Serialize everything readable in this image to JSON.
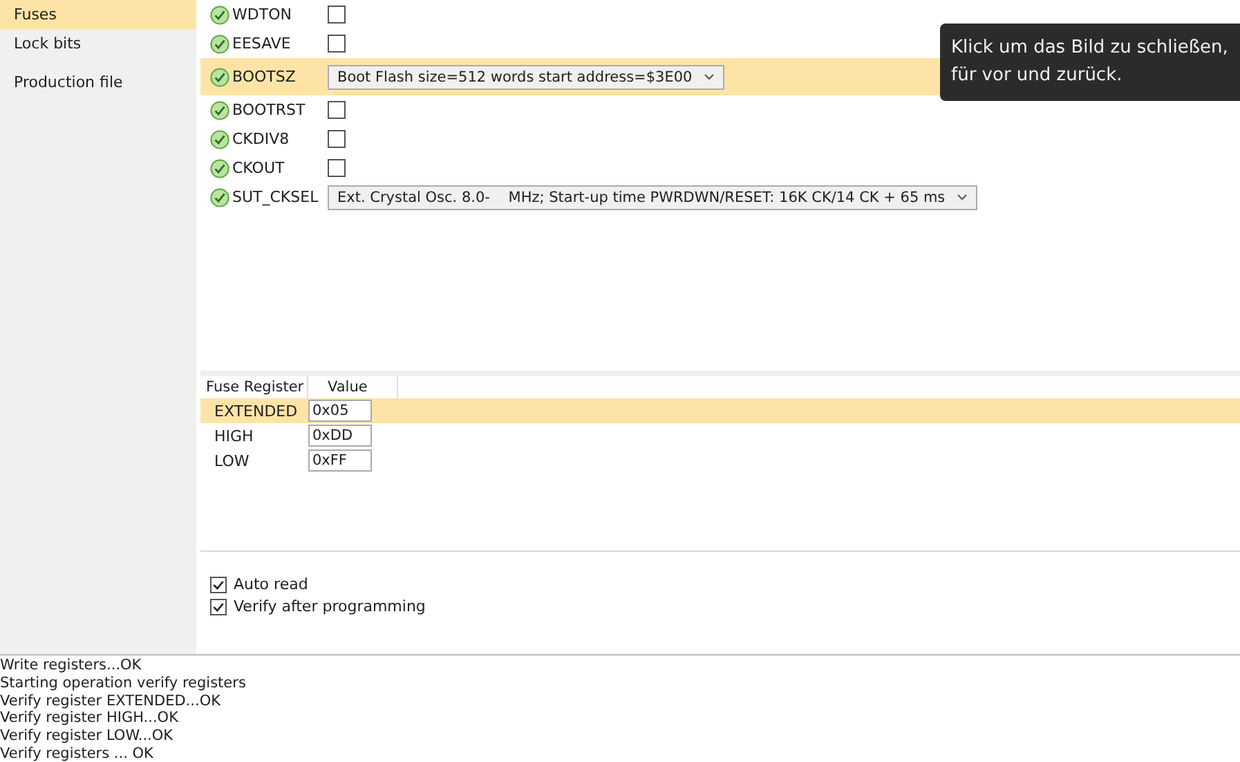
{
  "sidebar": {
    "items": [
      {
        "label": "Fuses",
        "selected": true
      },
      {
        "label": "Lock bits",
        "selected": false
      },
      {
        "label": "Production file",
        "selected": false
      }
    ]
  },
  "fuses": [
    {
      "name": "WDTON",
      "kind": "checkbox",
      "checked": false,
      "selected": false
    },
    {
      "name": "EESAVE",
      "kind": "checkbox",
      "checked": false,
      "selected": false
    },
    {
      "name": "BOOTSZ",
      "kind": "dropdown",
      "value": "Boot Flash size=512 words start address=$3E00",
      "selected": true
    },
    {
      "name": "BOOTRST",
      "kind": "checkbox",
      "checked": false,
      "selected": false
    },
    {
      "name": "CKDIV8",
      "kind": "checkbox",
      "checked": false,
      "selected": false
    },
    {
      "name": "CKOUT",
      "kind": "checkbox",
      "checked": false,
      "selected": false
    },
    {
      "name": "SUT_CKSEL",
      "kind": "dropdown",
      "value": "Ext. Crystal Osc. 8.0-    MHz; Start-up time PWRDWN/RESET: 16K CK/14 CK + 65 ms",
      "selected": false
    }
  ],
  "register_table": {
    "columns": [
      "Fuse Register",
      "Value"
    ],
    "rows": [
      {
        "register": "EXTENDED",
        "value": "0x05",
        "selected": true
      },
      {
        "register": "HIGH",
        "value": "0xDD",
        "selected": false
      },
      {
        "register": "LOW",
        "value": "0xFF",
        "selected": false
      }
    ]
  },
  "options": [
    {
      "label": "Auto read",
      "checked": true
    },
    {
      "label": "Verify after programming",
      "checked": true
    }
  ],
  "log": [
    "Write registers...OK",
    "Starting operation verify registers",
    "Verify register EXTENDED...OK",
    "Verify register HIGH...OK",
    "Verify register LOW...OK",
    "Verify registers ... OK"
  ],
  "tooltip": {
    "lines": [
      "Klick um das Bild zu schließen,",
      "für vor und zurück."
    ]
  }
}
